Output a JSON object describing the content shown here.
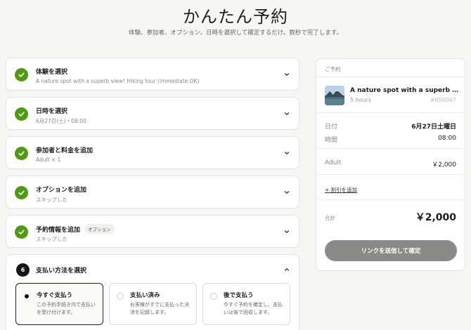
{
  "header": {
    "title": "かんたん予約",
    "subtitle": "体験、参加者、オプション、日時を選択して確定するだけ。数秒で完了します。"
  },
  "steps": [
    {
      "title": "体験を選択",
      "subtitle": "A nature spot with a superb view! Hiking tour (immediate OK)",
      "status": "complete"
    },
    {
      "title": "日時を選択",
      "subtitle": "6月27日(土)・08:00",
      "status": "complete"
    },
    {
      "title": "参加者と料金を追加",
      "subtitle": "Adult × 1",
      "status": "complete"
    },
    {
      "title": "オプションを追加",
      "subtitle": "スキップした",
      "status": "complete"
    },
    {
      "title": "予約情報を追加",
      "badge": "オプション",
      "subtitle": "スキップした",
      "status": "complete"
    }
  ],
  "payment_step": {
    "number": "6",
    "title": "支払い方法を選択",
    "options": [
      {
        "title": "今すぐ支払う",
        "desc": "この予約手続き内で支払いを受け付けます。",
        "selected": true
      },
      {
        "title": "支払い済み",
        "desc": "お客様がすでに支払った決済を記録します。",
        "selected": false
      },
      {
        "title": "後で支払う",
        "desc": "今すぐ予約を確定し、支払いは後で回収します。",
        "selected": false
      }
    ]
  },
  "summary": {
    "label": "ご予約",
    "experience_title": "A nature spot with a superb view! Hiking tour (immediate OK)",
    "duration": "5 hours",
    "id": "#650067",
    "date_label": "日付",
    "date_value": "6月27日土曜日",
    "time_label": "時間",
    "time_value": "08:00",
    "adult_label": "Adult",
    "adult_value": "￥2,000",
    "discount_link": "+ 割引を追加",
    "total_label": "合計",
    "total_value": "￥2,000",
    "submit_label": "リンクを送信して確定"
  },
  "colors": {
    "check_green": "#4e9a13",
    "submit_gray": "#8a8a88",
    "background": "#f6f6f4"
  }
}
